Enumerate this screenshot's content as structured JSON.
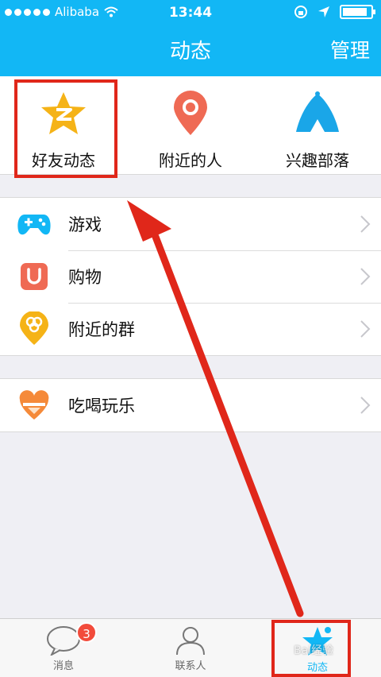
{
  "status_bar": {
    "carrier": "Alibaba",
    "time": "13:44"
  },
  "nav": {
    "title": "动态",
    "manage_label": "管理"
  },
  "quick_entries": [
    {
      "label": "好友动态",
      "icon": "qzone-star-icon",
      "color": "#f5b317"
    },
    {
      "label": "附近的人",
      "icon": "location-pin-icon",
      "color": "#ef6a54"
    },
    {
      "label": "兴趣部落",
      "icon": "tent-icon",
      "color": "#1aa6e8"
    }
  ],
  "list_group1": [
    {
      "label": "游戏",
      "icon": "gamepad-icon",
      "color": "#12b7f5"
    },
    {
      "label": "购物",
      "icon": "shopping-bag-icon",
      "color": "#ef6a54"
    },
    {
      "label": "附近的群",
      "icon": "nearby-group-icon",
      "color": "#f5b317"
    }
  ],
  "list_group2": [
    {
      "label": "吃喝玩乐",
      "icon": "food-heart-icon",
      "color": "#f58a3a"
    }
  ],
  "tabbar": {
    "messages_label": "消息",
    "messages_badge": "3",
    "contacts_label": "联系人",
    "moments_label": "动态"
  },
  "watermark": "Bai经验"
}
